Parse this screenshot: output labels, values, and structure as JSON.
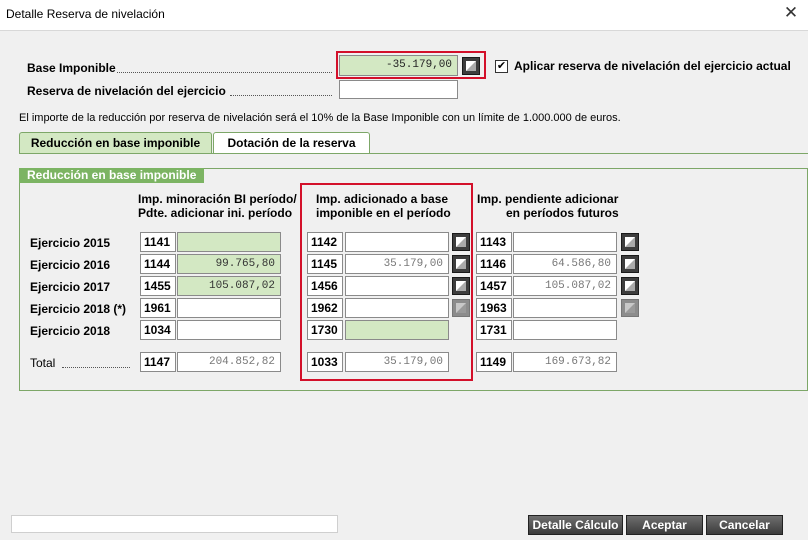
{
  "window": {
    "title": "Detalle Reserva de nivelación",
    "close_glyph": "✕"
  },
  "base": {
    "label": "Base Imponible",
    "value": "-35.179,00",
    "reserva_label": "Reserva de nivelación del ejercicio",
    "reserva_value": "",
    "checkbox_checked": true,
    "checkbox_glyph": "✔",
    "checkbox_label": "Aplicar reserva de nivelación del ejercicio actual"
  },
  "info_text": "El importe de la reducción por reserva de nivelación será el 10% de la Base Imponible con un límite de 1.000.000 de euros.",
  "tabs": [
    {
      "label": "Reducción en base imponible",
      "active": true
    },
    {
      "label": "Dotación de la reserva",
      "active": false
    }
  ],
  "group_title": "Reducción en base imponible",
  "columns": {
    "col1": {
      "line1": "Imp. minoración BI período/",
      "line2": "Pdte. adicionar ini. período"
    },
    "col2": {
      "line1": "Imp. adicionado a base",
      "line2": "imponible en el período"
    },
    "col3": {
      "line1": "Imp. pendiente adicionar",
      "line2": "en períodos futuros"
    }
  },
  "rows": [
    {
      "label": "Ejercicio 2015",
      "c1": "1141",
      "v1": "",
      "c2": "1142",
      "v2": "",
      "c3": "1143",
      "v3": ""
    },
    {
      "label": "Ejercicio 2016",
      "c1": "1144",
      "v1": "99.765,80",
      "c2": "1145",
      "v2": "35.179,00",
      "c3": "1146",
      "v3": "64.586,80"
    },
    {
      "label": "Ejercicio 2017",
      "c1": "1455",
      "v1": "105.087,02",
      "c2": "1456",
      "v2": "",
      "c3": "1457",
      "v3": "105.087,02"
    },
    {
      "label": "Ejercicio 2018 (*)",
      "c1": "1961",
      "v1": "",
      "c2": "1962",
      "v2": "",
      "c3": "1963",
      "v3": ""
    },
    {
      "label": "Ejercicio 2018",
      "c1": "1034",
      "v1": "",
      "c2": "1730",
      "v2": "",
      "c3": "1731",
      "v3": ""
    }
  ],
  "total": {
    "label": "Total",
    "c1": "1147",
    "v1": "204.852,82",
    "c2": "1033",
    "v2": "35.179,00",
    "c3": "1149",
    "v3": "169.673,82"
  },
  "buttons": {
    "detalle": "Detalle Cálculo",
    "aceptar": "Aceptar",
    "cancelar": "Cancelar"
  },
  "colors": {
    "highlight_red": "#d3102a",
    "group_green": "#7cb463",
    "field_green": "#d3e8c3"
  }
}
